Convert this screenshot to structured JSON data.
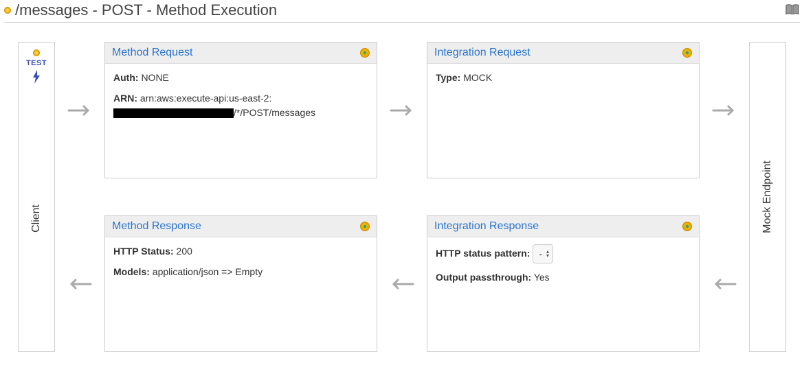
{
  "header": {
    "title": "/messages - POST - Method Execution"
  },
  "client": {
    "label": "Client",
    "test_label": "TEST"
  },
  "endpoint": {
    "label": "Mock Endpoint"
  },
  "cards": {
    "method_request": {
      "title": "Method Request",
      "auth_label": "Auth:",
      "auth_value": "NONE",
      "arn_label": "ARN:",
      "arn_prefix": "arn:aws:execute-api:us-east-2:",
      "arn_suffix": "/*/POST/messages"
    },
    "integration_request": {
      "title": "Integration Request",
      "type_label": "Type:",
      "type_value": "MOCK"
    },
    "method_response": {
      "title": "Method Response",
      "status_label": "HTTP Status:",
      "status_value": "200",
      "models_label": "Models:",
      "models_value": "application/json => Empty"
    },
    "integration_response": {
      "title": "Integration Response",
      "pattern_label": "HTTP status pattern:",
      "pattern_value": "-",
      "passthrough_label": "Output passthrough:",
      "passthrough_value": "Yes"
    }
  }
}
